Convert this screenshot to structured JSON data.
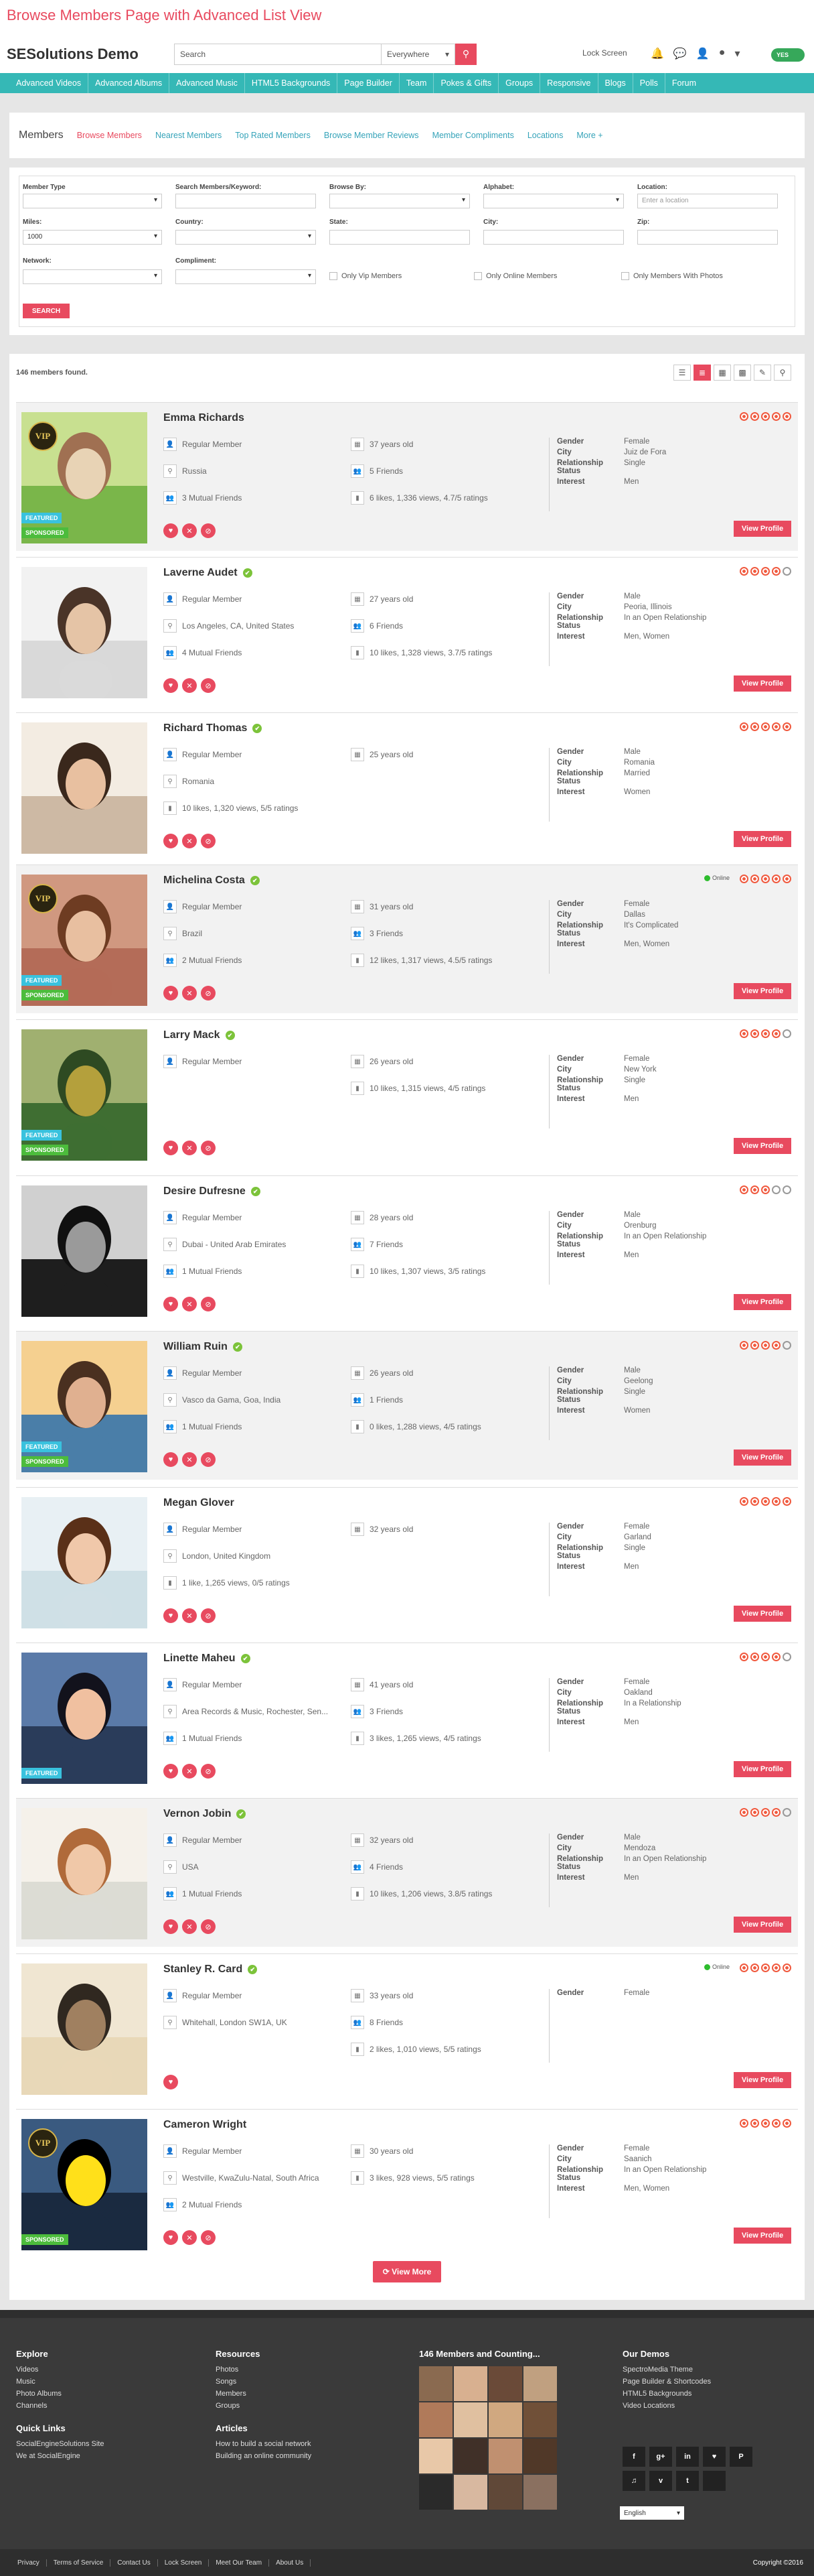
{
  "banner": "Browse Members Page with Advanced List View",
  "site": {
    "logo": "SESolutions Demo",
    "search_placeholder": "Search",
    "scope": "Everywhere",
    "lock": "Lock Screen",
    "toggle": "YES"
  },
  "nav": [
    "Advanced Videos",
    "Advanced Albums",
    "Advanced Music",
    "HTML5 Backgrounds",
    "Page Builder",
    "Team",
    "Pokes & Gifts",
    "Groups",
    "Responsive",
    "Blogs",
    "Polls",
    "Forum"
  ],
  "subnav": {
    "title": "Members",
    "items": [
      "Browse Members",
      "Nearest Members",
      "Top Rated Members",
      "Browse Member Reviews",
      "Member Compliments",
      "Locations",
      "More +"
    ]
  },
  "filters": {
    "member_type": "Member Type",
    "keyword": "Search Members/Keyword:",
    "browse_by": "Browse By:",
    "alphabet": "Alphabet:",
    "location": "Location:",
    "location_placeholder": "Enter a location",
    "miles": "Miles:",
    "miles_value": "1000",
    "country": "Country:",
    "state": "State:",
    "city": "City:",
    "zip": "Zip:",
    "network": "Network:",
    "compliment": "Compliment:",
    "vip": "Only Vip Members",
    "online": "Only Online Members",
    "photos": "Only Members With Photos",
    "search_btn": "SEARCH"
  },
  "results": {
    "count": "146 members found.",
    "view_more": "View More",
    "view_profile": "View Profile",
    "featured": "FEATURED",
    "sponsored": "SPONSORED",
    "vip": "VIP",
    "online": "Online"
  },
  "labels": {
    "gender": "Gender",
    "city": "City",
    "relationship": "Relationship",
    "status": "Status",
    "interest": "Interest"
  },
  "members": [
    {
      "name": "Emma Richards",
      "type": "Regular Member",
      "age": "37 years old",
      "loc": "Russia",
      "friends": "5 Friends",
      "mutual": "3 Mutual Friends",
      "stats": "6 likes, 1,336 views, 4.7/5 ratings",
      "gender": "Female",
      "city": "Juiz de Fora",
      "rel": "Single",
      "interest": "Men",
      "rating": 5
    },
    {
      "name": "Laverne Audet",
      "type": "Regular Member",
      "age": "27 years old",
      "loc": "Los Angeles, CA, United States",
      "friends": "6 Friends",
      "mutual": "4 Mutual Friends",
      "stats": "10 likes, 1,328 views, 3.7/5 ratings",
      "gender": "Male",
      "city": "Peoria, Illinois",
      "rel": "In an Open Relationship",
      "interest": "Men, Women",
      "rating": 4
    },
    {
      "name": "Richard Thomas",
      "type": "Regular Member",
      "age": "25 years old",
      "loc": "Romania",
      "friends": "",
      "mutual": "",
      "stats": "10 likes, 1,320 views, 5/5 ratings",
      "gender": "Male",
      "city": "Romania",
      "rel": "Married",
      "interest": "Women",
      "rating": 5
    },
    {
      "name": "Michelina Costa",
      "type": "Regular Member",
      "age": "31 years old",
      "loc": "Brazil",
      "friends": "3 Friends",
      "mutual": "2 Mutual Friends",
      "stats": "12 likes, 1,317 views, 4.5/5 ratings",
      "gender": "Female",
      "city": "Dallas",
      "rel": "It's Complicated",
      "interest": "Men, Women",
      "rating": 5
    },
    {
      "name": "Larry Mack",
      "type": "Regular Member",
      "age": "26 years old",
      "loc": "",
      "friends": "",
      "mutual": "",
      "stats": "10 likes, 1,315 views, 4/5 ratings",
      "gender": "Female",
      "city": "New York",
      "rel": "Single",
      "interest": "Men",
      "rating": 4
    },
    {
      "name": "Desire Dufresne",
      "type": "Regular Member",
      "age": "28 years old",
      "loc": "Dubai - United Arab Emirates",
      "friends": "7 Friends",
      "mutual": "1 Mutual Friends",
      "stats": "10 likes, 1,307 views, 3/5 ratings",
      "gender": "Male",
      "city": "Orenburg",
      "rel": "In an Open Relationship",
      "interest": "Men",
      "rating": 3
    },
    {
      "name": "William Ruin",
      "type": "Regular Member",
      "age": "26 years old",
      "loc": "Vasco da Gama, Goa, India",
      "friends": "1 Friends",
      "mutual": "1 Mutual Friends",
      "stats": "0 likes, 1,288 views, 4/5 ratings",
      "gender": "Male",
      "city": "Geelong",
      "rel": "Single",
      "interest": "Women",
      "rating": 4
    },
    {
      "name": "Megan Glover",
      "type": "Regular Member",
      "age": "32 years old",
      "loc": "London, United Kingdom",
      "friends": "",
      "mutual": "",
      "stats": "1 like, 1,265 views, 0/5 ratings",
      "gender": "Female",
      "city": "Garland",
      "rel": "Single",
      "interest": "Men",
      "rating": 5
    },
    {
      "name": "Linette Maheu",
      "type": "Regular Member",
      "age": "41 years old",
      "loc": "Area Records & Music, Rochester, Sen...",
      "friends": "3 Friends",
      "mutual": "1 Mutual Friends",
      "stats": "3 likes, 1,265 views, 4/5 ratings",
      "gender": "Female",
      "city": "Oakland",
      "rel": "In a Relationship",
      "interest": "Men",
      "rating": 4
    },
    {
      "name": "Vernon Jobin",
      "type": "Regular Member",
      "age": "32 years old",
      "loc": "USA",
      "friends": "4 Friends",
      "mutual": "1 Mutual Friends",
      "stats": "10 likes, 1,206 views, 3.8/5 ratings",
      "gender": "Male",
      "city": "Mendoza",
      "rel": "In an Open Relationship",
      "interest": "Men",
      "rating": 4
    },
    {
      "name": "Stanley R. Card",
      "type": "Regular Member",
      "age": "33 years old",
      "loc": "Whitehall, London SW1A, UK",
      "friends": "8 Friends",
      "mutual": "",
      "stats": "2 likes, 1,010 views, 5/5 ratings",
      "gender": "Female",
      "city": "",
      "rel": "",
      "interest": "",
      "rating": 5
    },
    {
      "name": "Cameron Wright",
      "type": "Regular Member",
      "age": "30 years old",
      "loc": "Westville, KwaZulu-Natal, South Africa",
      "friends": "",
      "mutual": "2 Mutual Friends",
      "stats": "3 likes, 928 views, 5/5 ratings",
      "gender": "Female",
      "city": "Saanich",
      "rel": "In an Open Relationship",
      "interest": "Men, Women",
      "rating": 5
    }
  ],
  "footer": {
    "explore": {
      "title": "Explore",
      "items": [
        "Videos",
        "Music",
        "Photo Albums",
        "Channels"
      ]
    },
    "resources": {
      "title": "Resources",
      "items": [
        "Photos",
        "Songs",
        "Members",
        "Groups"
      ]
    },
    "quick": {
      "title": "Quick Links",
      "items": [
        "SocialEngineSolutions Site",
        "We at SocialEngine"
      ]
    },
    "articles": {
      "title": "Articles",
      "items": [
        "How to build a social network",
        "Building an online community"
      ]
    },
    "members_title": "146 Members and Counting...",
    "demos": {
      "title": "Our Demos",
      "items": [
        "SpectroMedia Theme",
        "Page Builder & Shortcodes",
        "HTML5 Backgrounds",
        "Video Locations"
      ]
    },
    "social": [
      "f",
      "g+",
      "in",
      "♥",
      "P",
      "♫",
      "v",
      "t",
      ""
    ],
    "lang": "English",
    "links": [
      "Privacy",
      "Terms of Service",
      "Contact Us",
      "Lock Screen",
      "Meet Our Team",
      "About Us"
    ],
    "copyright": "Copyright ©2016"
  }
}
